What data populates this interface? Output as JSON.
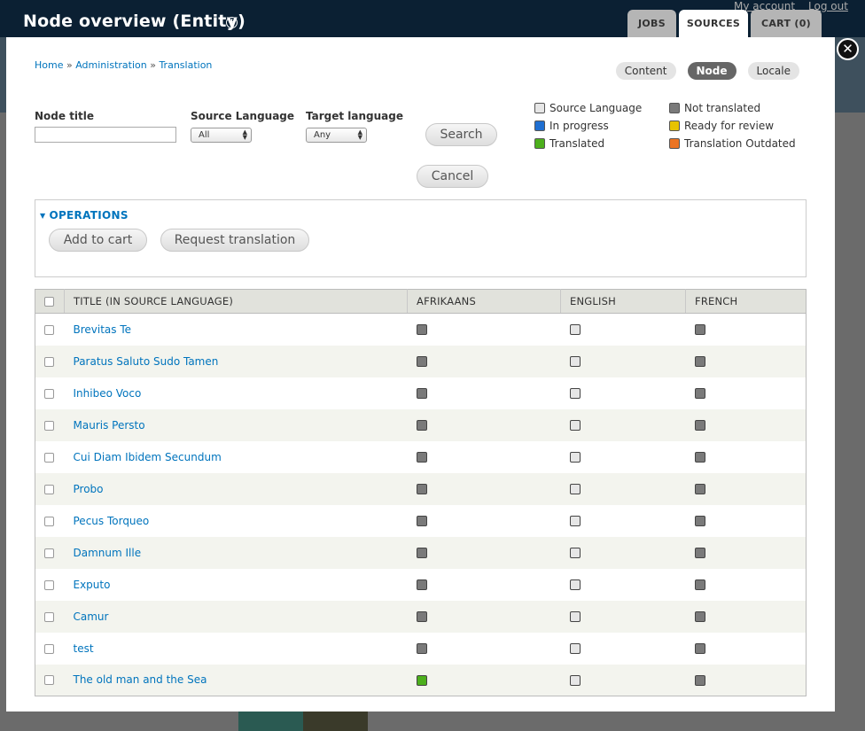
{
  "page": {
    "title": "Node overview (Entity)",
    "account_links": [
      "My account",
      "Log out"
    ],
    "top_tabs": [
      {
        "label": "JOBS",
        "active": false
      },
      {
        "label": "SOURCES",
        "active": true
      },
      {
        "label": "CART (0)",
        "active": false
      }
    ]
  },
  "breadcrumb": {
    "items": [
      "Home",
      "Administration",
      "Translation"
    ],
    "separator": "»"
  },
  "source_type_pills": [
    {
      "label": "Content",
      "active": false
    },
    {
      "label": "Node",
      "active": true
    },
    {
      "label": "Locale",
      "active": false
    }
  ],
  "filters": {
    "node_title_label": "Node title",
    "node_title_value": "",
    "source_language_label": "Source Language",
    "source_language_value": "All",
    "target_language_label": "Target language",
    "target_language_value": "Any",
    "search_label": "Search",
    "cancel_label": "Cancel"
  },
  "legend": [
    {
      "label": "Source Language",
      "color": "#e6e6e6"
    },
    {
      "label": "Not translated",
      "color": "#7a7a7a"
    },
    {
      "label": "In progress",
      "color": "#1f6fd1"
    },
    {
      "label": "Ready for review",
      "color": "#e7c300"
    },
    {
      "label": "Translated",
      "color": "#4caf1c"
    },
    {
      "label": "Translation Outdated",
      "color": "#ec7423"
    }
  ],
  "operations": {
    "legend": "OPERATIONS",
    "buttons": [
      "Add to cart",
      "Request translation"
    ]
  },
  "table": {
    "columns": [
      "TITLE (IN SOURCE LANGUAGE)",
      "AFRIKAANS",
      "ENGLISH",
      "FRENCH"
    ],
    "status_colors": {
      "source": "#e6e6e6",
      "not_translated": "#7a7a7a",
      "translated": "#4caf1c"
    },
    "rows": [
      {
        "title": "Brevitas Te",
        "afrikaans": "not_translated",
        "english": "source",
        "french": "not_translated"
      },
      {
        "title": "Paratus Saluto Sudo Tamen",
        "afrikaans": "not_translated",
        "english": "source",
        "french": "not_translated"
      },
      {
        "title": "Inhibeo Voco",
        "afrikaans": "not_translated",
        "english": "source",
        "french": "not_translated"
      },
      {
        "title": "Mauris Persto",
        "afrikaans": "not_translated",
        "english": "source",
        "french": "not_translated"
      },
      {
        "title": "Cui Diam Ibidem Secundum",
        "afrikaans": "not_translated",
        "english": "source",
        "french": "not_translated"
      },
      {
        "title": "Probo",
        "afrikaans": "not_translated",
        "english": "source",
        "french": "not_translated"
      },
      {
        "title": "Pecus Torqueo",
        "afrikaans": "not_translated",
        "english": "source",
        "french": "not_translated"
      },
      {
        "title": "Damnum Ille",
        "afrikaans": "not_translated",
        "english": "source",
        "french": "not_translated"
      },
      {
        "title": "Exputo",
        "afrikaans": "not_translated",
        "english": "source",
        "french": "not_translated"
      },
      {
        "title": "Camur",
        "afrikaans": "not_translated",
        "english": "source",
        "french": "not_translated"
      },
      {
        "title": "test",
        "afrikaans": "not_translated",
        "english": "source",
        "french": "not_translated"
      },
      {
        "title": "The old man and the Sea",
        "afrikaans": "translated",
        "english": "source",
        "french": "not_translated"
      }
    ]
  }
}
